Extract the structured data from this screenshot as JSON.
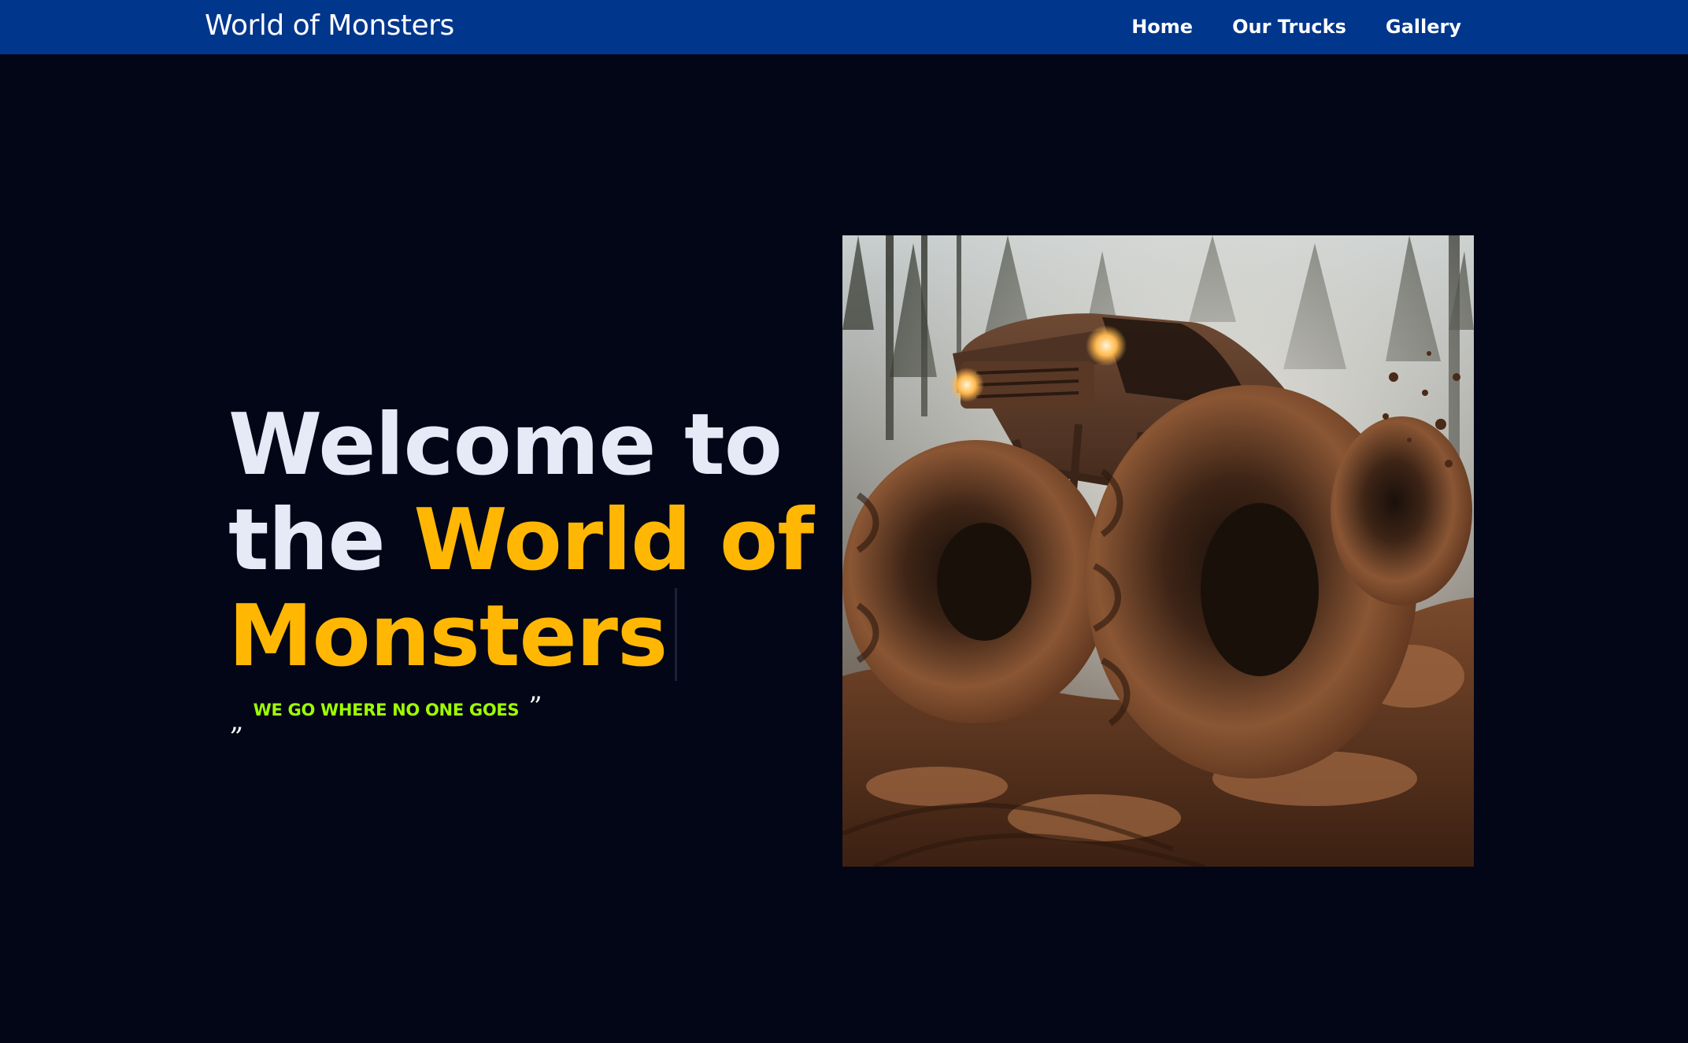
{
  "navbar": {
    "brand": "World of Monsters",
    "links": [
      "Home",
      "Our Trucks",
      "Gallery"
    ],
    "background_color": "#00368c"
  },
  "hero": {
    "heading_plain_1": "Welcome to",
    "heading_plain_2": "the ",
    "heading_accent_1": "World of",
    "heading_accent_2": "Monsters",
    "tagline_open_quote": "„",
    "tagline": "WE GO WHERE NO ONE GOES",
    "tagline_close_quote": "”",
    "accent_color": "#ffb703",
    "tagline_color": "#9dff00",
    "image_subject": "muddy monster truck in forest"
  },
  "page": {
    "background_color": "#030617"
  }
}
